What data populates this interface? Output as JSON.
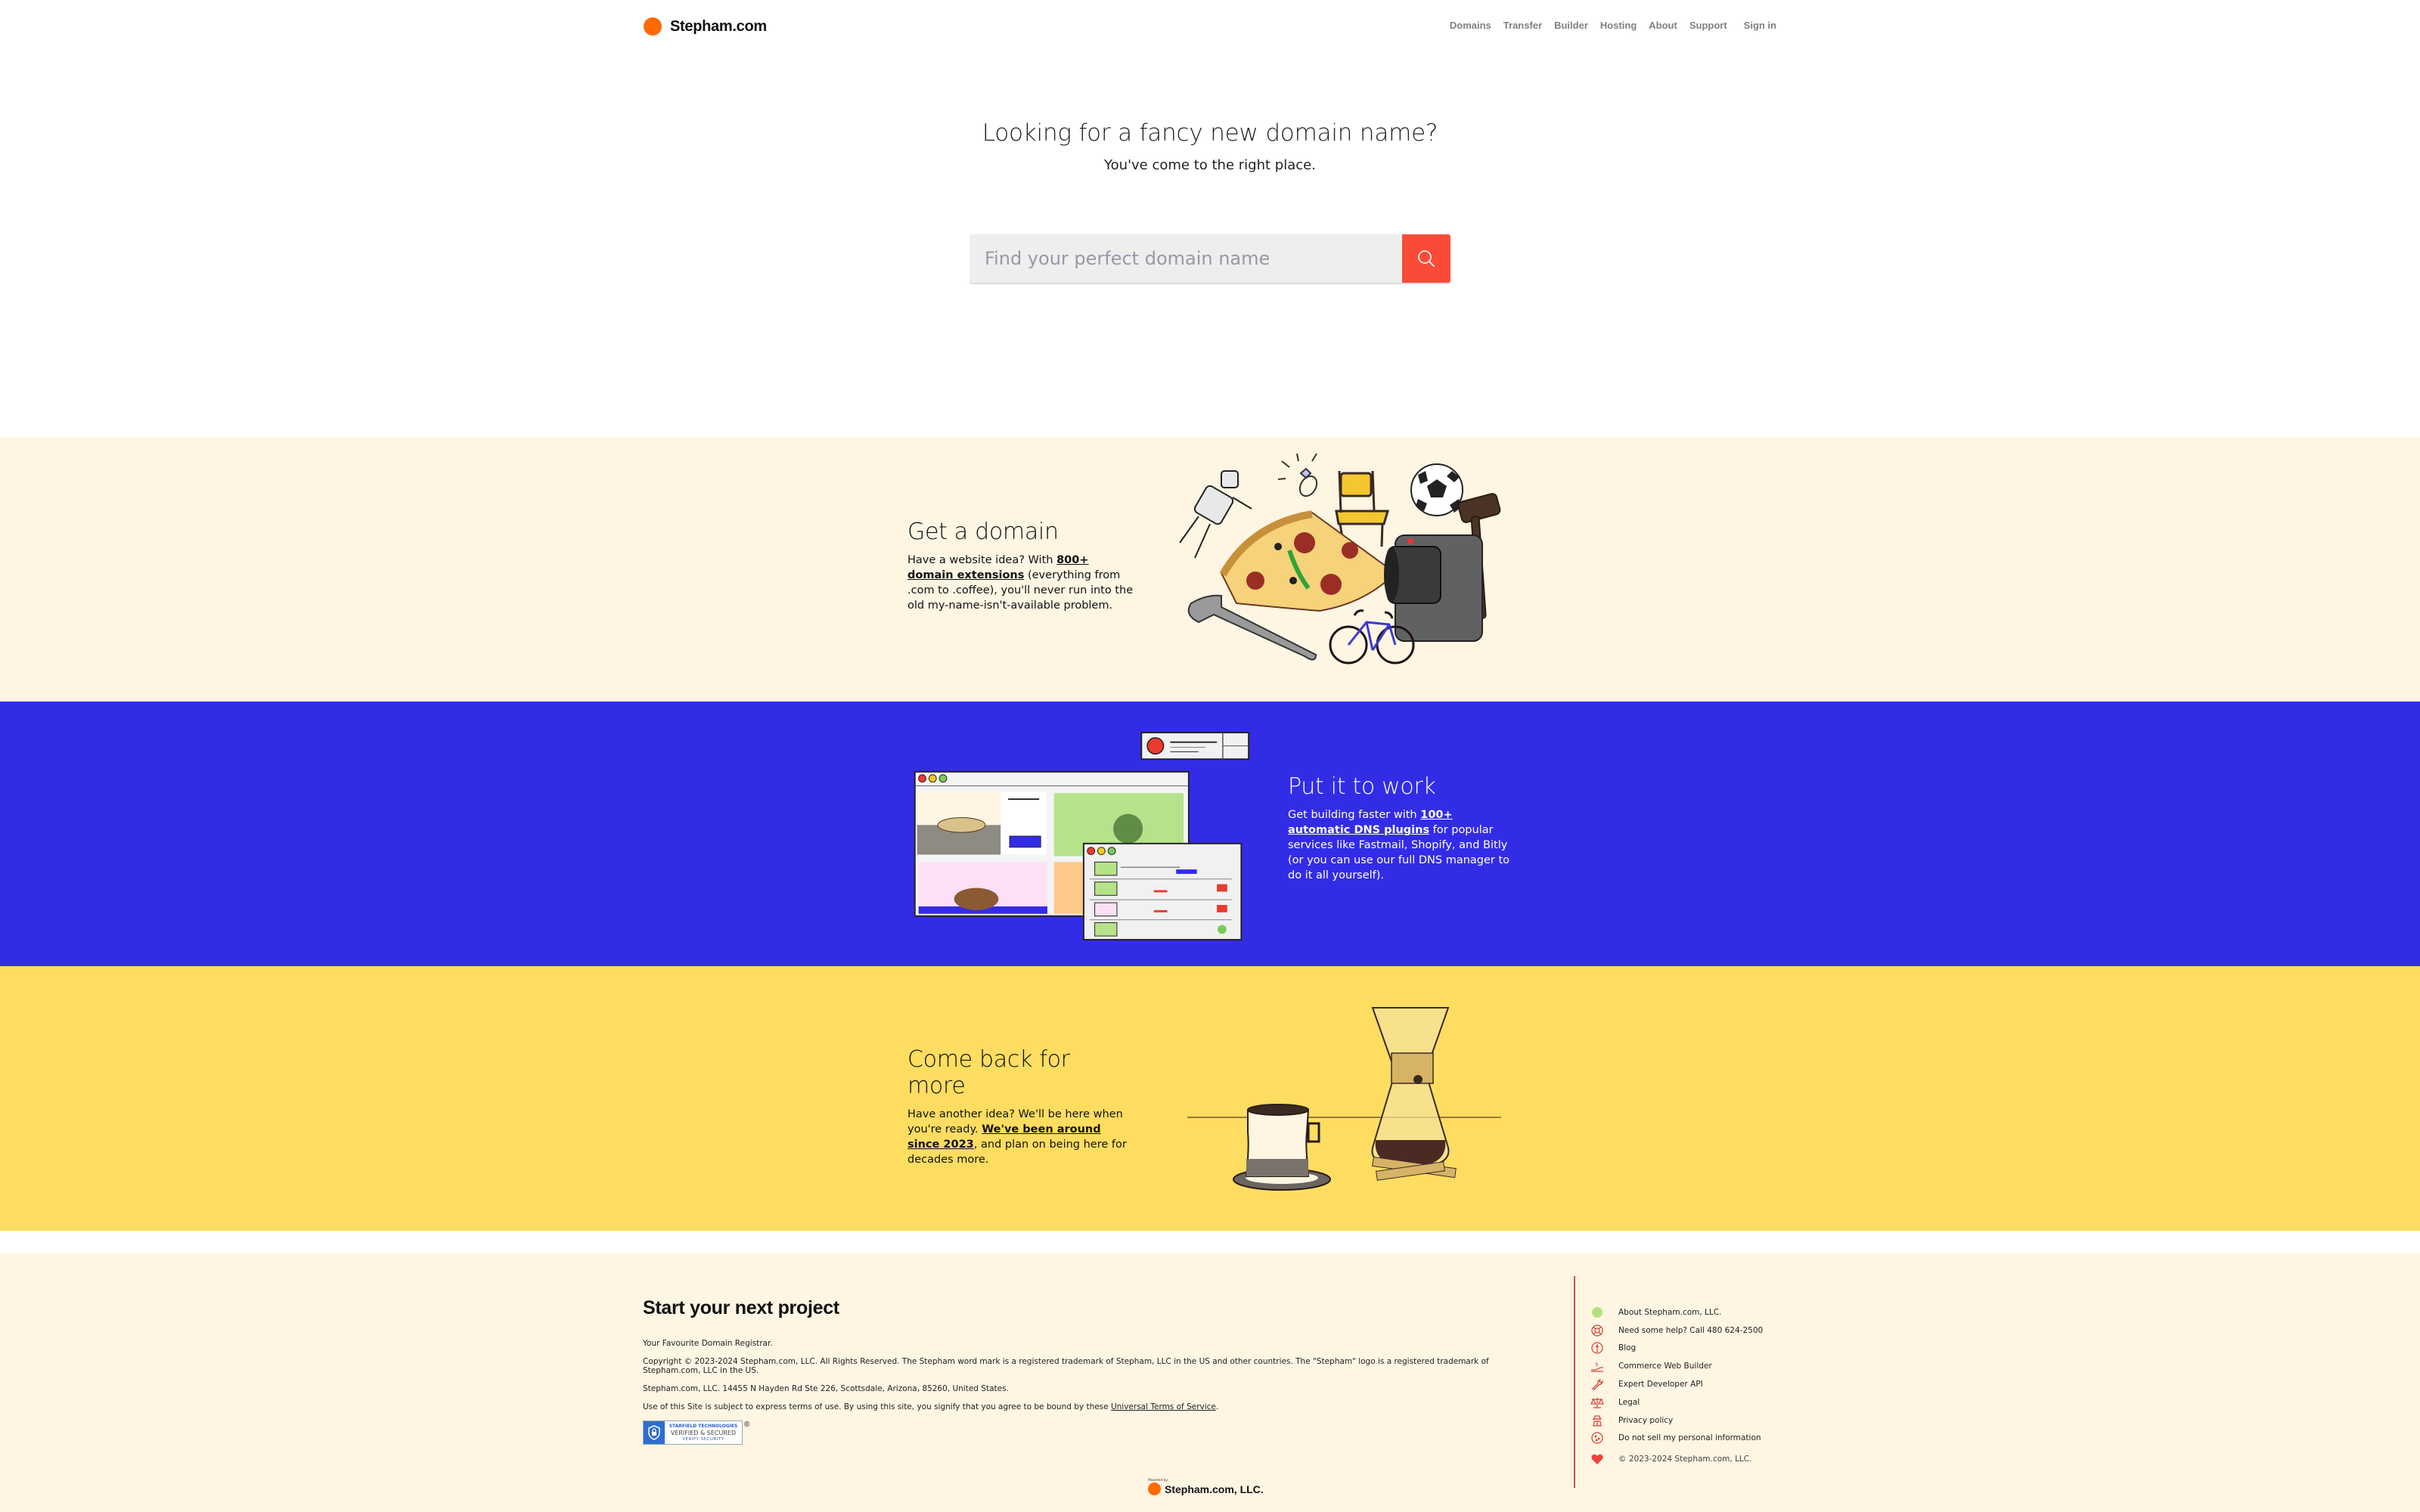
{
  "brand": {
    "name": "Stepham.com",
    "color": "#ff6a00"
  },
  "nav": {
    "links": [
      "Domains",
      "Transfer",
      "Builder",
      "Hosting",
      "About",
      "Support"
    ],
    "signin": "Sign in"
  },
  "hero": {
    "title": "Looking for a fancy new domain name?",
    "subtitle": "You've come to the right place.",
    "search_placeholder": "Find your perfect domain name",
    "search_value": "",
    "search_button_color": "#fa4b39"
  },
  "features": [
    {
      "title": "Get a domain",
      "pre": "Have a website idea? With ",
      "link": "800+ domain extensions",
      "post": " (everything from .com to .coffee), you'll never run into the old my-name-isn't-available problem.",
      "bg": "#fef5e3",
      "illustration": "assorted objects: robot toy, ring, chair, soccer ball, gavel, pizza slice, camera, wrench, bicycle"
    },
    {
      "title": "Put it to work",
      "pre": "Get building faster with ",
      "link": "100+ automatic DNS plugins",
      "post": " for popular services like Fastmail, Shopify, and Bitly (or you can use our full DNS manager to do it all yourself).",
      "bg": "#332ce7",
      "illustration": "browser windows showing an online bakery store and order list"
    },
    {
      "title": "Come back for more",
      "pre": "Have another idea? We'll be here when you're ready. ",
      "link": "We've been around since 2023",
      "post": ", and plan on being here for decades more.",
      "bg": "#fedd61",
      "illustration": "coffee cup and pour-over coffee maker"
    }
  ],
  "footer": {
    "heading": "Start your next project",
    "tagline": "Your Favourite Domain Registrar.",
    "copyright": "Copyright © 2023-2024 Stepham.com, LLC. All Rights Reserved. The Stepham word mark is a registered trademark of Stepham, LLC in the US and other countries. The \"Stepham\" logo is a registered trademark of Stepham.com, LLC in the US.",
    "address": "Stepham.com, LLC. 14455 N Hayden Rd Ste 226, Scottsdale, Arizona, 85260, United States.",
    "terms_pre": "Use of this Site is subject to express terms of use. By using this site, you signify that you agree to be bound by these ",
    "terms_link": "Universal Terms of Service",
    "terms_post": ".",
    "badge": {
      "line1": "STARFIELD TECHNOLOGIES",
      "line2": "VERIFIED & SECURED",
      "line3": "VERIFY SECURITY",
      "reg": "®"
    },
    "links": [
      {
        "label": "About Stepham.com, LLC.",
        "icon": "green-dot-icon"
      },
      {
        "label": "Need some help? Call 480 624-2500",
        "icon": "lifebuoy-icon"
      },
      {
        "label": "Blog",
        "icon": "brain-icon"
      },
      {
        "label": "Commerce Web Builder",
        "icon": "hand-dollar-icon"
      },
      {
        "label": "Expert Developer API",
        "icon": "wrench-icon"
      },
      {
        "label": "Legal",
        "icon": "scales-icon"
      },
      {
        "label": "Privacy policy",
        "icon": "spy-icon"
      },
      {
        "label": "Do not sell my personal information",
        "icon": "cookie-icon"
      }
    ],
    "copyright_short": "© 2023-2024 Stepham.com, LLC.",
    "powered_by": "Powered by",
    "powered_name": "Stepham.com, LLC."
  }
}
